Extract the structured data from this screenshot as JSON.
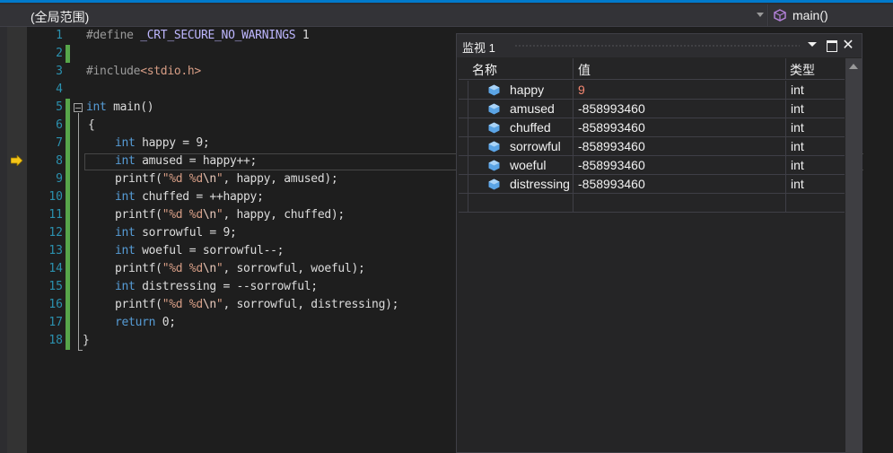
{
  "navbar": {
    "scope": "(全局范围)",
    "function": "main()"
  },
  "editor": {
    "lines": [
      {
        "num": "1"
      },
      {
        "num": "2"
      },
      {
        "num": "3"
      },
      {
        "num": "4"
      },
      {
        "num": "5"
      },
      {
        "num": "6"
      },
      {
        "num": "7"
      },
      {
        "num": "8"
      },
      {
        "num": "9"
      },
      {
        "num": "10"
      },
      {
        "num": "11"
      },
      {
        "num": "12"
      },
      {
        "num": "13"
      },
      {
        "num": "14"
      },
      {
        "num": "15"
      },
      {
        "num": "16"
      },
      {
        "num": "17"
      },
      {
        "num": "18"
      }
    ],
    "code": {
      "l1_define": "#define",
      "l1_macro": "_CRT_SECURE_NO_WARNINGS",
      "l1_rest": " 1",
      "l3_include": "#include",
      "l3_header": "<stdio.h>",
      "l5_int": "int",
      "l5_rest": " main()",
      "l6": "{",
      "l7_int": "int",
      "l7_rest": " happy = 9;",
      "l8_int": "int",
      "l8_rest": " amused = happy++;",
      "l9_a": "printf(",
      "l9_s1": "\"%d %d",
      "l9_e": "\\n",
      "l9_s2": "\"",
      "l9_b": ", happy, amused);",
      "l10_int": "int",
      "l10_rest": " chuffed = ++happy;",
      "l11_a": "printf(",
      "l11_s1": "\"%d %d",
      "l11_e": "\\n",
      "l11_s2": "\"",
      "l11_b": ", happy, chuffed);",
      "l12_int": "int",
      "l12_rest": " sorrowful = 9;",
      "l13_int": "int",
      "l13_rest": " woeful = sorrowful--;",
      "l14_a": "printf(",
      "l14_s1": "\"%d %d",
      "l14_e": "\\n",
      "l14_s2": "\"",
      "l14_b": ", sorrowful, woeful);",
      "l15_int": "int",
      "l15_rest": " distressing = --sorrowful;",
      "l16_a": "printf(",
      "l16_s1": "\"%d %d",
      "l16_e": "\\n",
      "l16_s2": "\"",
      "l16_b": ", sorrowful, distressing);",
      "l17_ret": "return",
      "l17_rest": " 0;",
      "l18": "}"
    }
  },
  "watch": {
    "title": "监视 1",
    "headers": {
      "name": "名称",
      "value": "值",
      "type": "类型"
    },
    "rows": [
      {
        "name": "happy",
        "value": "9",
        "type": "int"
      },
      {
        "name": "amused",
        "value": "-858993460",
        "type": "int"
      },
      {
        "name": "chuffed",
        "value": "-858993460",
        "type": "int"
      },
      {
        "name": "sorrowful",
        "value": "-858993460",
        "type": "int"
      },
      {
        "name": "woeful",
        "value": "-858993460",
        "type": "int"
      },
      {
        "name": "distressing",
        "value": "-858993460",
        "type": "int"
      }
    ]
  },
  "colors": {
    "accent": "#007acc",
    "keyword": "#569cd6",
    "string": "#d69d85",
    "line_number": "#2b91af",
    "change_bar": "#57a64a",
    "changed_value": "#f48771"
  }
}
